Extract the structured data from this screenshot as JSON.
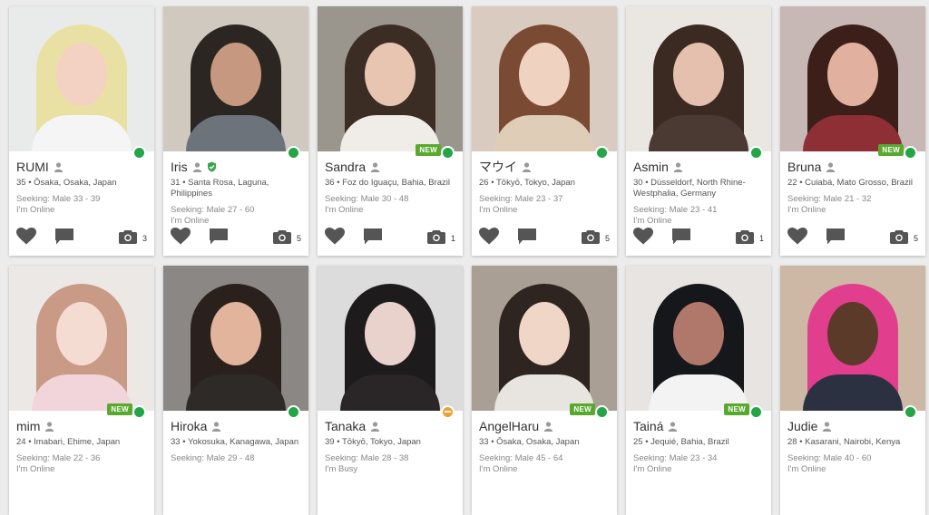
{
  "seeking_label": "Seeking:",
  "profiles": [
    {
      "name": "RUMI",
      "location": "35 • Ōsaka, Osaka, Japan",
      "seeking": "Seeking: Male 33 - 39",
      "status": "I'm Online",
      "photos": "3",
      "is_new": false,
      "verified": false,
      "status_color": "#23a548",
      "palette": {
        "bg": "#e9ebea",
        "hair": "#e9e1a3",
        "face": "#f3d2c4",
        "body": "#f5f5f5"
      }
    },
    {
      "name": "Iris",
      "location": "31 • Santa Rosa, Laguna, Philippines",
      "seeking": "Seeking: Male 27 - 60",
      "status": "I'm Online",
      "photos": "5",
      "is_new": false,
      "verified": true,
      "status_color": "#23a548",
      "palette": {
        "bg": "#cfc9c0",
        "hair": "#2c2622",
        "face": "#c69880",
        "body": "#6d737b"
      }
    },
    {
      "name": "Sandra",
      "location": "36 • Foz do Iguaçu, Bahia, Brazil",
      "seeking": "Seeking: Male 30 - 48",
      "status": "I'm Online",
      "photos": "1",
      "is_new": true,
      "verified": false,
      "status_color": "#23a548",
      "palette": {
        "bg": "#9a958d",
        "hair": "#3c2d24",
        "face": "#e8c5b0",
        "body": "#f0ede8"
      }
    },
    {
      "name": "マウイ",
      "location": "26 • Tōkyō, Tokyo, Japan",
      "seeking": "Seeking: Male 23 - 37",
      "status": "I'm Online",
      "photos": "5",
      "is_new": false,
      "verified": false,
      "status_color": "#23a548",
      "palette": {
        "bg": "#d9cbc0",
        "hair": "#7a4a33",
        "face": "#efd2c0",
        "body": "#e0cdb7"
      }
    },
    {
      "name": "Asmin",
      "location": "30 • Düsseldorf, North Rhine-Westphalia, Germany",
      "seeking": "Seeking: Male 23 - 41",
      "status": "I'm Online",
      "photos": "1",
      "is_new": false,
      "verified": false,
      "status_color": "#23a548",
      "palette": {
        "bg": "#eae6e2",
        "hair": "#3b2a22",
        "face": "#e6c0ae",
        "body": "#4b3a33"
      }
    },
    {
      "name": "Bruna",
      "location": "22 • Cuiabá, Mato Grosso, Brazil",
      "seeking": "Seeking: Male 21 - 32",
      "status": "I'm Online",
      "photos": "5",
      "is_new": true,
      "verified": false,
      "status_color": "#23a548",
      "palette": {
        "bg": "#c7b8b5",
        "hair": "#3d1f1a",
        "face": "#e2b09e",
        "body": "#8d2f35"
      }
    },
    {
      "name": "mim",
      "location": "24 • Imabari, Ehime, Japan",
      "seeking": "Seeking: Male 22 - 36",
      "status": "I'm Online",
      "photos": "",
      "is_new": true,
      "verified": false,
      "status_color": "#23a548",
      "palette": {
        "bg": "#ece8e6",
        "hair": "#c99b86",
        "face": "#f5dcd2",
        "body": "#f2d5da"
      }
    },
    {
      "name": "Hiroka",
      "location": "33 • Yokosuka, Kanagawa, Japan",
      "seeking": "Seeking: Male 29 - 48",
      "status": "",
      "photos": "",
      "is_new": false,
      "verified": false,
      "status_color": "#23a548",
      "palette": {
        "bg": "#8a8784",
        "hair": "#2b211c",
        "face": "#e3b49c",
        "body": "#2e2a28"
      }
    },
    {
      "name": "Tanaka",
      "location": "39 • Tōkyō, Tokyo, Japan",
      "seeking": "Seeking: Male 28 - 38",
      "status": "I'm Busy",
      "photos": "",
      "is_new": false,
      "verified": false,
      "status_color": "#f0a030",
      "palette": {
        "bg": "#dddcdc",
        "hair": "#1e1b1c",
        "face": "#ead2cc",
        "body": "#2a2526"
      }
    },
    {
      "name": "AngelHaru",
      "location": "33 • Ōsaka, Osaka, Japan",
      "seeking": "Seeking: Male 45 - 64",
      "status": "I'm Online",
      "photos": "",
      "is_new": true,
      "verified": false,
      "status_color": "#23a548",
      "palette": {
        "bg": "#a99f95",
        "hair": "#2f2520",
        "face": "#efd6c7",
        "body": "#e8e4e0"
      }
    },
    {
      "name": "Tainá",
      "location": "25 • Jequié, Bahia, Brazil",
      "seeking": "Seeking: Male 23 - 34",
      "status": "I'm Online",
      "photos": "",
      "is_new": true,
      "verified": false,
      "status_color": "#23a548",
      "palette": {
        "bg": "#e7e4e2",
        "hair": "#15171a",
        "face": "#b0786a",
        "body": "#f3f3f3"
      }
    },
    {
      "name": "Judie",
      "location": "28 • Kasarani, Nairobi, Kenya",
      "seeking": "Seeking: Male 40 - 60",
      "status": "I'm Online",
      "photos": "",
      "is_new": false,
      "verified": false,
      "status_color": "#23a548",
      "palette": {
        "bg": "#cdb8a6",
        "hair": "#e23e8e",
        "face": "#5b3a2a",
        "body": "#2c3142"
      }
    }
  ],
  "badges": {
    "new_label": "NEW"
  },
  "colors": {
    "accent_green": "#23a548",
    "new_badge": "#5aa92f",
    "icon_gray": "#555555",
    "verified_green": "#3aa64c"
  },
  "icons": {
    "favorite": "heart-icon",
    "message": "chat-bubble-icon",
    "photos": "camera-icon",
    "profile": "user-icon",
    "verified": "shield-check-icon"
  }
}
